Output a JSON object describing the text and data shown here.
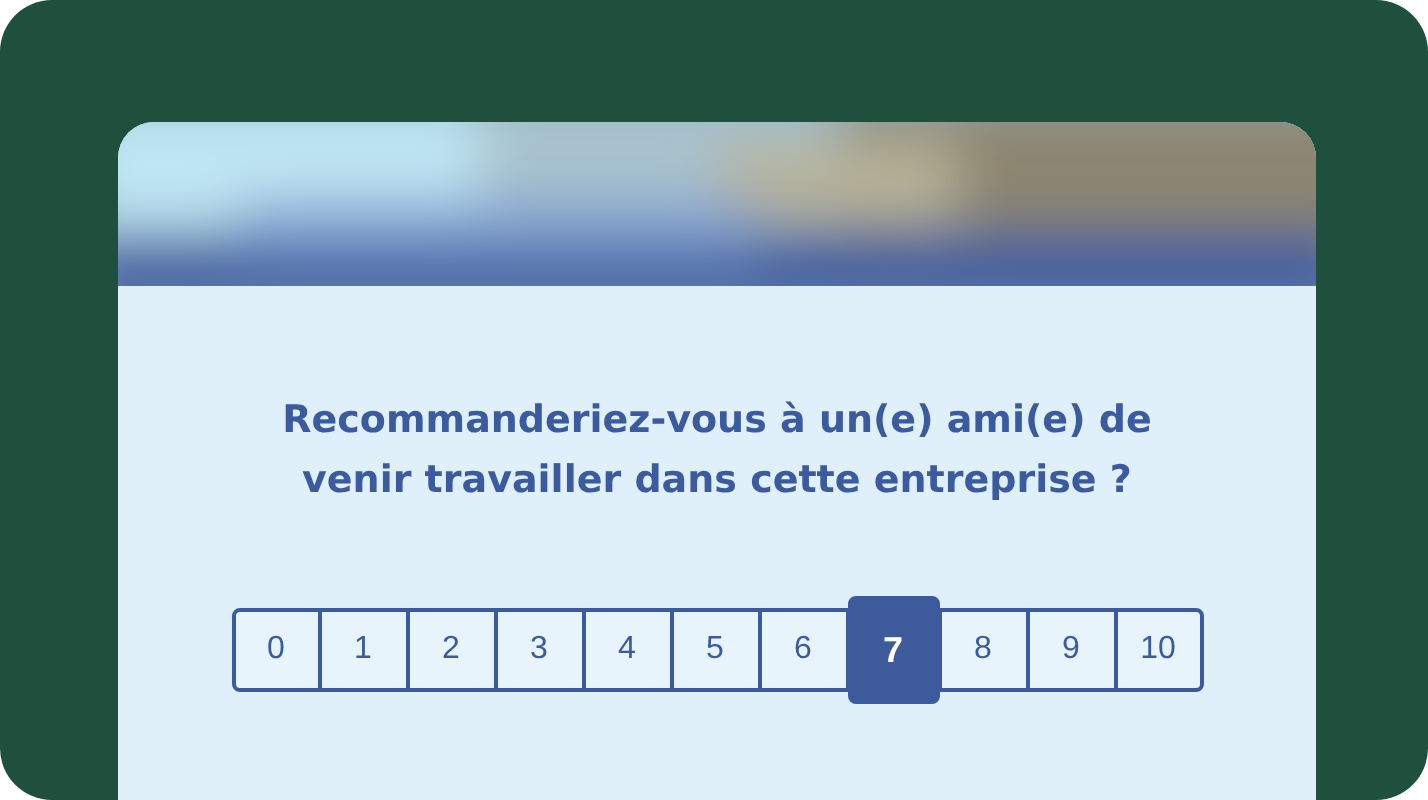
{
  "card": {
    "question": "Recommanderiez-vous à un(e) ami(e) de venir travailler dans cette entreprise ?",
    "scale": [
      {
        "label": "0",
        "selected": false
      },
      {
        "label": "1",
        "selected": false
      },
      {
        "label": "2",
        "selected": false
      },
      {
        "label": "3",
        "selected": false
      },
      {
        "label": "4",
        "selected": false
      },
      {
        "label": "5",
        "selected": false
      },
      {
        "label": "6",
        "selected": false
      },
      {
        "label": "7",
        "selected": true
      },
      {
        "label": "8",
        "selected": false
      },
      {
        "label": "9",
        "selected": false
      },
      {
        "label": "10",
        "selected": false
      }
    ]
  }
}
